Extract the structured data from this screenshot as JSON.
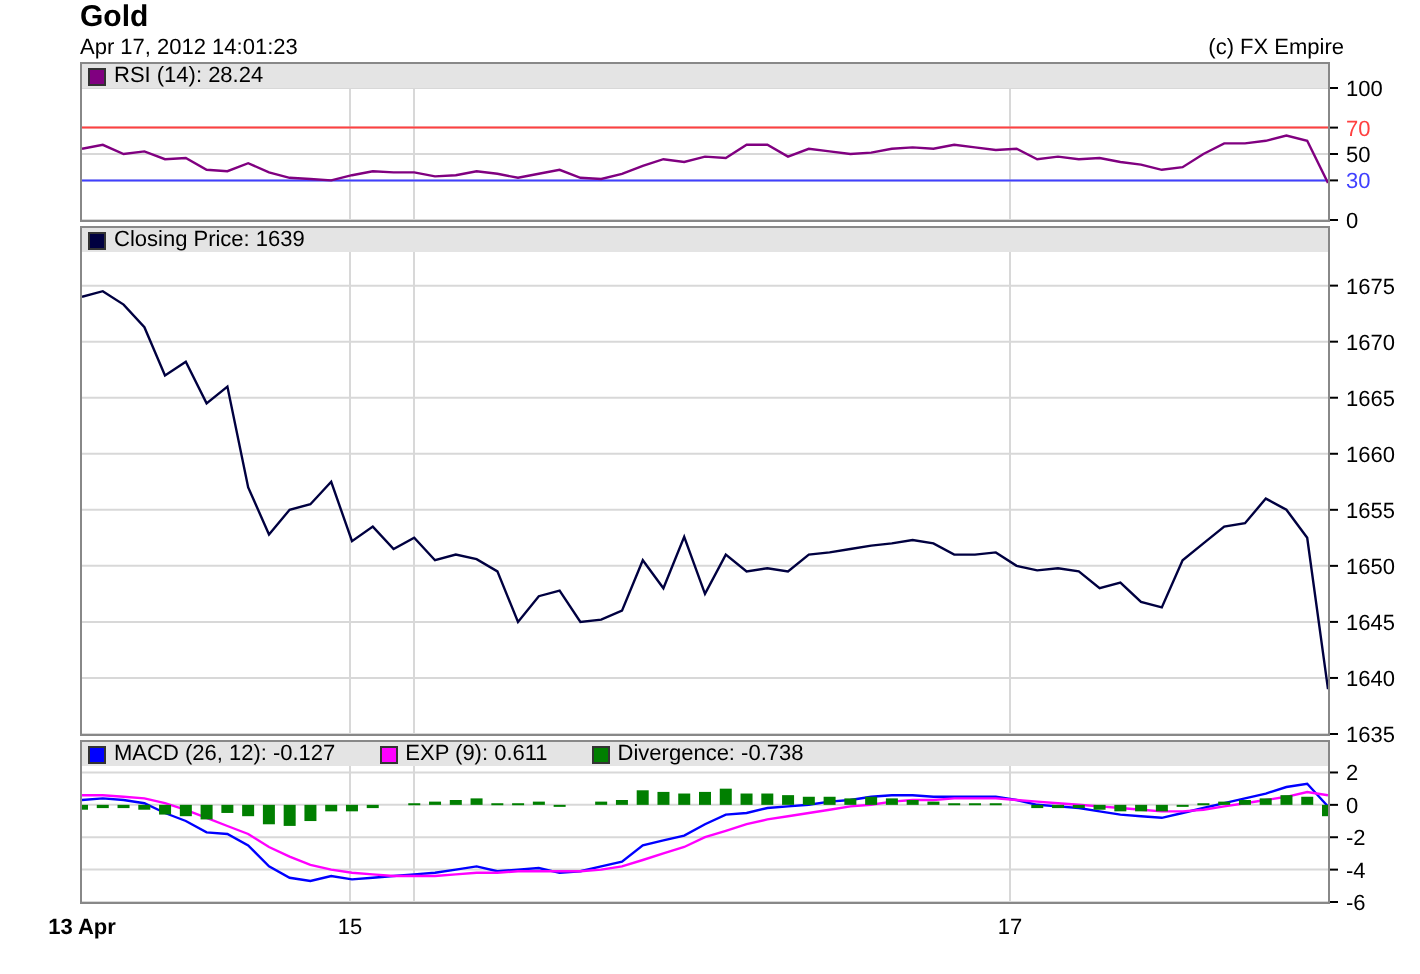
{
  "title": "Gold",
  "timestamp": "Apr 17, 2012 14:01:23",
  "copyright": "(c) FX Empire",
  "panels": [
    {
      "chart_data": {
        "type": "line",
        "grid": true,
        "legend": "top",
        "ylim": [
          0,
          100
        ],
        "yticks": [
          0,
          30,
          50,
          70,
          100
        ],
        "ref_lines": [
          {
            "axis": "y",
            "value": 70,
            "color": "#ff4040"
          },
          {
            "axis": "y",
            "value": 30,
            "color": "#4040ff"
          }
        ],
        "series": [
          {
            "name": "RSI (14): 28.24",
            "color": "#800080",
            "values": [
              54,
              57,
              50,
              52,
              46,
              47,
              38,
              37,
              43,
              36,
              32,
              31,
              30,
              34,
              37,
              36,
              36,
              33,
              34,
              37,
              35,
              32,
              35,
              38,
              32,
              31,
              35,
              41,
              46,
              44,
              48,
              47,
              57,
              57,
              48,
              54,
              52,
              50,
              51,
              54,
              55,
              54,
              57,
              55,
              53,
              54,
              46,
              48,
              46,
              47,
              44,
              42,
              38,
              40,
              50,
              58,
              58,
              60,
              64,
              60,
              28
            ]
          }
        ]
      }
    },
    {
      "chart_data": {
        "type": "line",
        "grid": true,
        "legend": "top",
        "ylim": [
          1635,
          1678
        ],
        "yticks": [
          1635,
          1640,
          1645,
          1650,
          1655,
          1660,
          1665,
          1670,
          1675
        ],
        "series": [
          {
            "name": "Closing Price: 1639",
            "color": "#000040",
            "values": [
              1674,
              1674.5,
              1673.3,
              1671.3,
              1667,
              1668.2,
              1664.5,
              1666,
              1657,
              1652.8,
              1655,
              1655.5,
              1657.5,
              1652.2,
              1653.5,
              1651.5,
              1652.5,
              1650.5,
              1651,
              1650.6,
              1649.5,
              1645,
              1647.3,
              1647.8,
              1645,
              1645.2,
              1646,
              1650.5,
              1648,
              1652.6,
              1647.5,
              1651,
              1649.5,
              1649.8,
              1649.5,
              1651,
              1651.2,
              1651.5,
              1651.8,
              1652,
              1652.3,
              1652,
              1651,
              1651,
              1651.2,
              1650,
              1649.6,
              1649.8,
              1649.5,
              1648,
              1648.5,
              1646.8,
              1646.3,
              1650.5,
              1652,
              1653.5,
              1653.8,
              1656,
              1655,
              1652.5,
              1639
            ]
          }
        ]
      }
    },
    {
      "chart_data": {
        "type": "line",
        "grid": true,
        "legend": "top",
        "ylim": [
          -6,
          2.4
        ],
        "yticks": [
          -6,
          -4,
          -2,
          0,
          2
        ],
        "series": [
          {
            "name": "MACD (26, 12): -0.127",
            "color": "#0000ff",
            "values": [
              0.3,
              0.4,
              0.3,
              0.1,
              -0.5,
              -1.0,
              -1.7,
              -1.8,
              -2.5,
              -3.8,
              -4.5,
              -4.7,
              -4.4,
              -4.6,
              -4.5,
              -4.4,
              -4.3,
              -4.2,
              -4.0,
              -3.8,
              -4.1,
              -4.0,
              -3.9,
              -4.2,
              -4.1,
              -3.8,
              -3.5,
              -2.5,
              -2.2,
              -1.9,
              -1.2,
              -0.6,
              -0.5,
              -0.2,
              -0.1,
              0,
              0.2,
              0.3,
              0.5,
              0.6,
              0.6,
              0.5,
              0.5,
              0.5,
              0.5,
              0.3,
              0,
              -0.1,
              -0.2,
              -0.4,
              -0.6,
              -0.7,
              -0.8,
              -0.5,
              -0.2,
              0.1,
              0.4,
              0.7,
              1.1,
              1.3,
              -0.1
            ]
          },
          {
            "name": "EXP (9): 0.611",
            "color": "#ff00ff",
            "values": [
              0.6,
              0.6,
              0.5,
              0.4,
              0.1,
              -0.3,
              -0.8,
              -1.3,
              -1.8,
              -2.6,
              -3.2,
              -3.7,
              -4.0,
              -4.2,
              -4.3,
              -4.4,
              -4.4,
              -4.4,
              -4.3,
              -4.2,
              -4.2,
              -4.1,
              -4.1,
              -4.1,
              -4.1,
              -4.0,
              -3.8,
              -3.4,
              -3.0,
              -2.6,
              -2.0,
              -1.6,
              -1.2,
              -0.9,
              -0.7,
              -0.5,
              -0.3,
              -0.1,
              0,
              0.2,
              0.3,
              0.3,
              0.4,
              0.4,
              0.4,
              0.3,
              0.2,
              0.1,
              0,
              -0.1,
              -0.2,
              -0.3,
              -0.4,
              -0.4,
              -0.3,
              -0.1,
              0.1,
              0.3,
              0.5,
              0.8,
              0.6
            ]
          },
          {
            "name": "Divergence: -0.738",
            "type": "bar",
            "color": "#007f00",
            "values": [
              -0.3,
              -0.2,
              -0.2,
              -0.3,
              -0.6,
              -0.7,
              -0.9,
              -0.5,
              -0.7,
              -1.2,
              -1.3,
              -1.0,
              -0.4,
              -0.4,
              -0.2,
              0,
              0.1,
              0.2,
              0.3,
              0.4,
              0.1,
              0.1,
              0.2,
              -0.1,
              0,
              0.2,
              0.3,
              0.9,
              0.8,
              0.7,
              0.8,
              1.0,
              0.7,
              0.7,
              0.6,
              0.5,
              0.5,
              0.4,
              0.5,
              0.4,
              0.3,
              0.2,
              0.1,
              0.1,
              0.1,
              0,
              -0.2,
              -0.2,
              -0.2,
              -0.3,
              -0.4,
              -0.4,
              -0.4,
              -0.1,
              0.1,
              0.2,
              0.3,
              0.4,
              0.6,
              0.5,
              -0.7
            ]
          }
        ]
      }
    }
  ],
  "time_axis": [
    "13 Apr",
    "15",
    "17"
  ]
}
